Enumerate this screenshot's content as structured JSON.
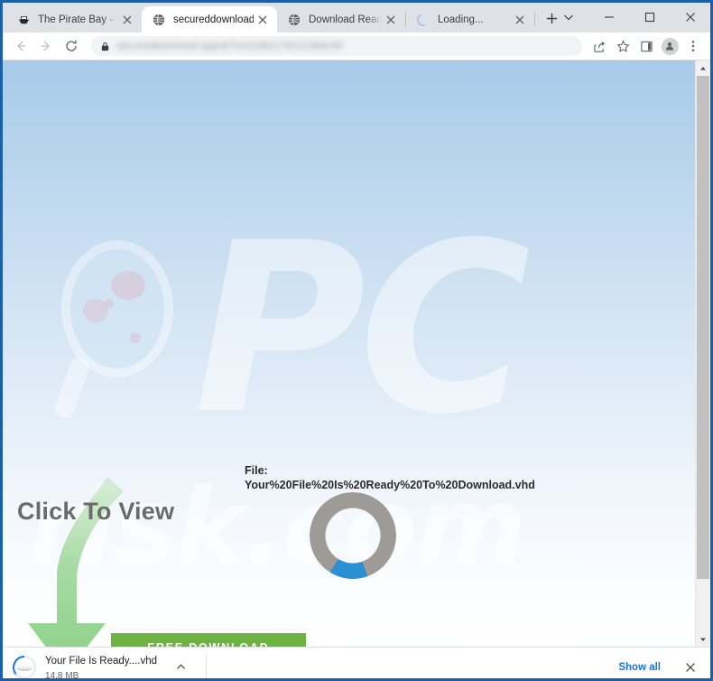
{
  "window": {
    "controls": {
      "tab_search_label": "Search tabs",
      "minimize_label": "Minimize",
      "maximize_label": "Maximize",
      "close_label": "Close"
    }
  },
  "tabs": [
    {
      "title": "The Pirate Bay - The g",
      "favicon": "ship-icon",
      "active": false,
      "loading": false
    },
    {
      "title": "secureddownload",
      "favicon": "globe-icon",
      "active": true,
      "loading": false
    },
    {
      "title": "Download Ready",
      "favicon": "globe-icon",
      "active": false,
      "loading": false
    },
    {
      "title": "Loading...",
      "favicon": "spinner-icon",
      "active": false,
      "loading": true
    }
  ],
  "newtab_label": "+",
  "toolbar": {
    "back_label": "Back",
    "forward_label": "Forward",
    "reload_label": "Reload",
    "url": "secureddownload.app/d/7e4118b21782213b9c38",
    "lock_icon": "lock-icon",
    "share_label": "Share",
    "bookmark_label": "Bookmark this tab",
    "side_panel_label": "Side panel",
    "profile_label": "Profile",
    "menu_label": "Customize and control"
  },
  "page": {
    "watermark_pc": "PC",
    "watermark_risk": "risk.com",
    "click_to_view": "Click To View",
    "file_label": "File:",
    "file_name": "Your%20File%20Is%20Ready%20To%20Download.vhd",
    "free_download_label": "FREE DOWNLOAD",
    "progress_percent": 14,
    "colors": {
      "button_green": "#6cb33f",
      "ring_gray": "#9e9a96",
      "ring_blue": "#2b8fd4",
      "arrow_green": "#8ed08a",
      "page_top": "#a7cbe9"
    }
  },
  "downloads_shelf": {
    "item_name": "Your File Is Ready....vhd",
    "item_size": "14.8 MB",
    "item_icon": "vhd-file-icon",
    "expand_label": "Show more options",
    "show_all_label": "Show all",
    "close_label": "Close"
  }
}
